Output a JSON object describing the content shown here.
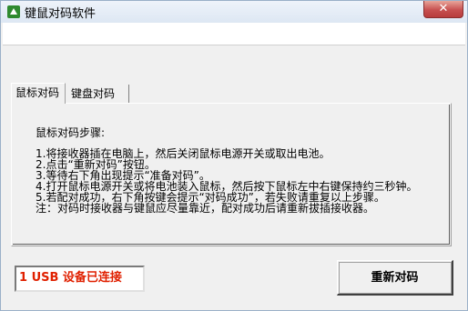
{
  "window": {
    "title": "键鼠对码软件",
    "close_glyph": "✕"
  },
  "tabs": [
    {
      "label": "鼠标对码",
      "active": true
    },
    {
      "label": "键盘对码",
      "active": false
    }
  ],
  "instructions": {
    "title": "鼠标对码步骤:",
    "lines": [
      "1.将接收器插在电脑上，然后关闭鼠标电源开关或取出电池。",
      "2.点击“重新对码”按钮。",
      "3.等待右下角出现提示“准备对码”。",
      "4.打开鼠标电源开关或将电池装入鼠标，然后按下鼠标左中右键保持约三秒钟。",
      "5.若配对成功，右下角按键会提示“对码成功”，若失败请重复以上步骤。",
      "注：对码时接收器与键鼠应尽量靠近，配对成功后请重新拔插接收器。"
    ]
  },
  "status": {
    "text": "1 USB 设备已连接",
    "color": "#e02000"
  },
  "actions": {
    "reconnect_label": "重新对码"
  }
}
